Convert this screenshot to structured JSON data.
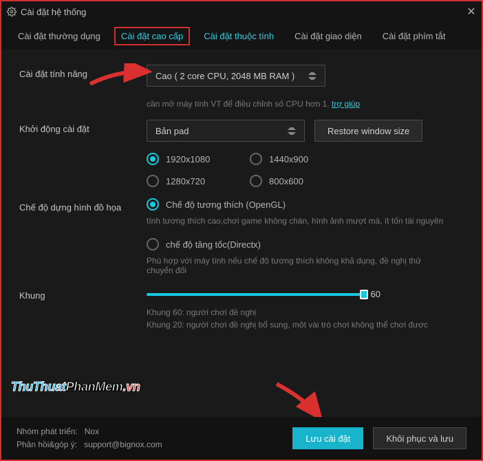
{
  "window": {
    "title": "Cài đặt hệ thống"
  },
  "tabs": [
    "Cài đặt thường dụng",
    "Cài đặt cao cấp",
    "Cài đặt thuộc tính",
    "Cài đặt giao diện",
    "Cài đặt phím tắt"
  ],
  "perf": {
    "label": "Cài đặt tính năng",
    "value": "Cao ( 2 core CPU, 2048 MB RAM )",
    "hint_prefix": "cần mở máy tính VT để điều chỉnh số CPU hơn 1. ",
    "hint_link": "trợ giúp"
  },
  "boot": {
    "label": "Khởi động cài đặt",
    "value": "Bản pad",
    "restore": "Restore window size",
    "resolutions": [
      "1920x1080",
      "1440x900",
      "1280x720",
      "800x600"
    ],
    "selected": 0
  },
  "render": {
    "label": "Chế độ dựng hình đồ họa",
    "opt1": "Chế độ tương thích (OpenGL)",
    "desc1": "tính tương thích cao,chơi game không chán, hình ảnh mượt mà, ít tốn tài nguyên",
    "opt2": "chế độ tăng tốc(Directx)",
    "desc2": "Phù hợp với máy tính nếu chế độ tương thích không khả dụng, đề nghị thử chuyển đổi"
  },
  "frame": {
    "label": "Khung",
    "value": "60",
    "note1": "Khung 60: người chơi đề nghị",
    "note2": "Khung 20: người chơi đề nghị bổ sung, một vài trò chơi không thể chơi được"
  },
  "watermark": {
    "t1": "ThuThuat",
    "t2": "PhanMem",
    "t3": ".vn"
  },
  "footer": {
    "dev_label": "Nhóm phát triển:",
    "dev_val": "Nox",
    "fb_label": "Phản hồi&góp ý:",
    "fb_val": "support@bignox.com",
    "save": "Lưu cài đặt",
    "restore": "Khôi phục và lưu"
  }
}
